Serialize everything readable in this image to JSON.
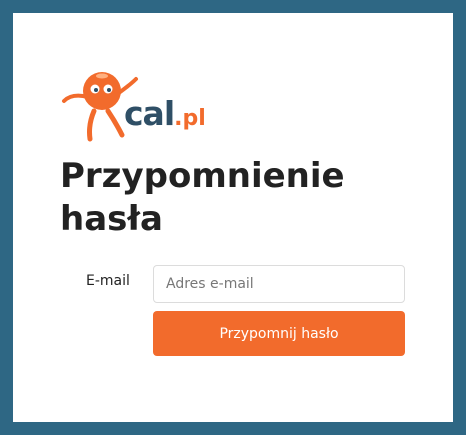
{
  "logo": {
    "brand_name": "cal",
    "brand_tld": ".pl",
    "mascot_icon": "orange-mascot-icon",
    "colors": {
      "orange": "#f26b2c",
      "navy": "#2f4f66"
    }
  },
  "form": {
    "title": "Przypomnienie hasła",
    "email_label": "E-mail",
    "email_placeholder": "Adres e-mail",
    "email_value": "",
    "submit_label": "Przypomnij hasło"
  },
  "colors": {
    "frame": "#2e6784",
    "card": "#ffffff",
    "accent": "#f26b2c"
  }
}
